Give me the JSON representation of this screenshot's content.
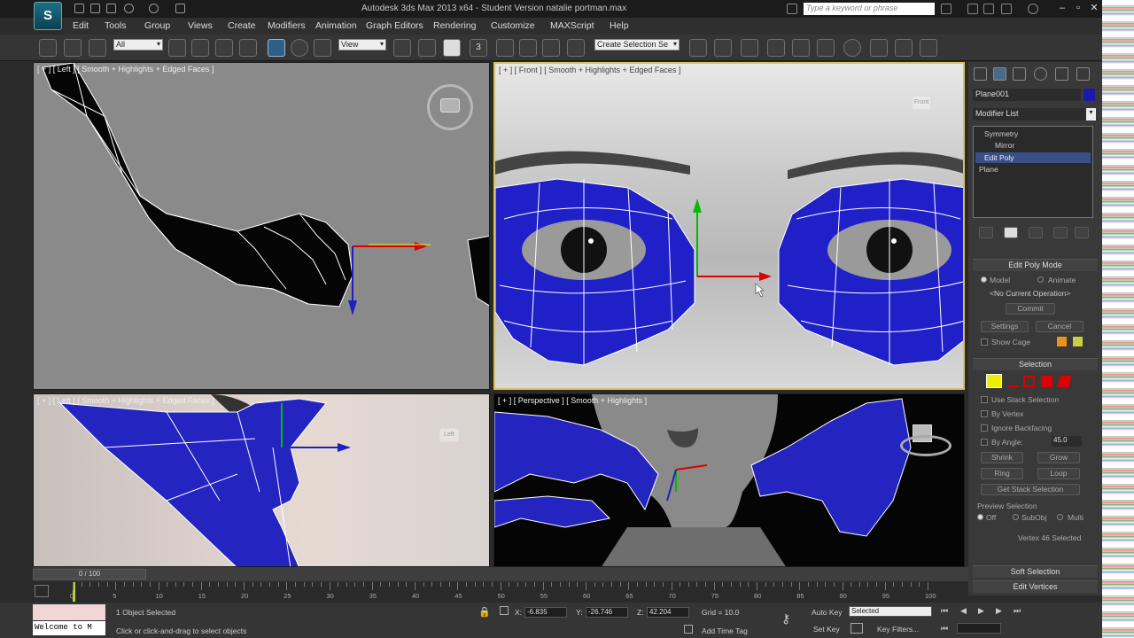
{
  "window": {
    "title": "Autodesk 3ds Max  2013 x64  -  Student Version    natalie portman.max",
    "search_placeholder": "Type a keyword or phrase",
    "logo_text": "S"
  },
  "menus": [
    "Edit",
    "Tools",
    "Group",
    "Views",
    "Create",
    "Modifiers",
    "Animation",
    "Graph Editors",
    "Rendering",
    "Customize",
    "MAXScript",
    "Help"
  ],
  "toolbar": {
    "filter_value": "All",
    "refcoord_value": "View",
    "named_sel_value": "Create Selection Se",
    "snap_number": "3"
  },
  "viewports": {
    "top_left": {
      "label": "[ + ] [ Left ] [ Smooth + Highlights + Edged Faces ]"
    },
    "top_right": {
      "label": "[ + ] [ Front ] [ Smooth + Highlights + Edged Faces ]",
      "cube_label": "Front"
    },
    "bottom_left": {
      "label": "[ + ] [ Left ] [ Smooth + Highlights + Edged Faces ]",
      "cube_label": "Left"
    },
    "bottom_right": {
      "label": "[ + ] [ Perspective ] [ Smooth + Highlights ]"
    }
  },
  "command_panel": {
    "object_name": "Plane001",
    "object_color": "#1a1aa8",
    "modifier_list_label": "Modifier List",
    "stack": [
      "Symmetry",
      "Mirror",
      "Edit Poly",
      "Plane"
    ],
    "rollout_edit_poly_mode": "Edit Poly Mode",
    "radio_model": "Model",
    "radio_animate": "Animate",
    "no_operation": "<No Current Operation>",
    "commit": "Commit",
    "settings": "Settings",
    "cancel": "Cancel",
    "show_cage": "Show Cage",
    "rollout_selection": "Selection",
    "use_stack_selection": "Use Stack Selection",
    "by_vertex": "By Vertex",
    "ignore_backfacing": "Ignore Backfacing",
    "by_angle": "By Angle:",
    "angle_value": "45.0",
    "shrink": "Shrink",
    "grow": "Grow",
    "ring": "Ring",
    "loop": "Loop",
    "get_stack_selection": "Get Stack Selection",
    "preview_selection": "Preview Selection",
    "preview_off": "Off",
    "preview_subobj": "SubObj",
    "preview_multi": "Multi",
    "vertex_selected": "Vertex 46 Selected",
    "soft_selection": "Soft Selection",
    "edit_vertices": "Edit Vertices"
  },
  "timeline": {
    "frame_label": "0 / 100",
    "ticks": [
      "0",
      "5",
      "10",
      "15",
      "20",
      "25",
      "30",
      "35",
      "40",
      "45",
      "50",
      "55",
      "60",
      "65",
      "70",
      "75",
      "80",
      "85",
      "90",
      "95",
      "100"
    ]
  },
  "status": {
    "maxscript_text": "Welcome to M",
    "objects_selected": "1 Object Selected",
    "prompt": "Click or click-and-drag to select objects",
    "x_label": "X:",
    "x_value": "-6.835",
    "y_label": "Y:",
    "y_value": "-26.746",
    "z_label": "Z:",
    "z_value": "42.204",
    "grid": "Grid = 10.0",
    "add_time_tag": "Add Time Tag",
    "auto_key": "Auto Key",
    "set_key": "Set Key",
    "key_mode_value": "Selected",
    "key_filters": "Key Filters..."
  }
}
